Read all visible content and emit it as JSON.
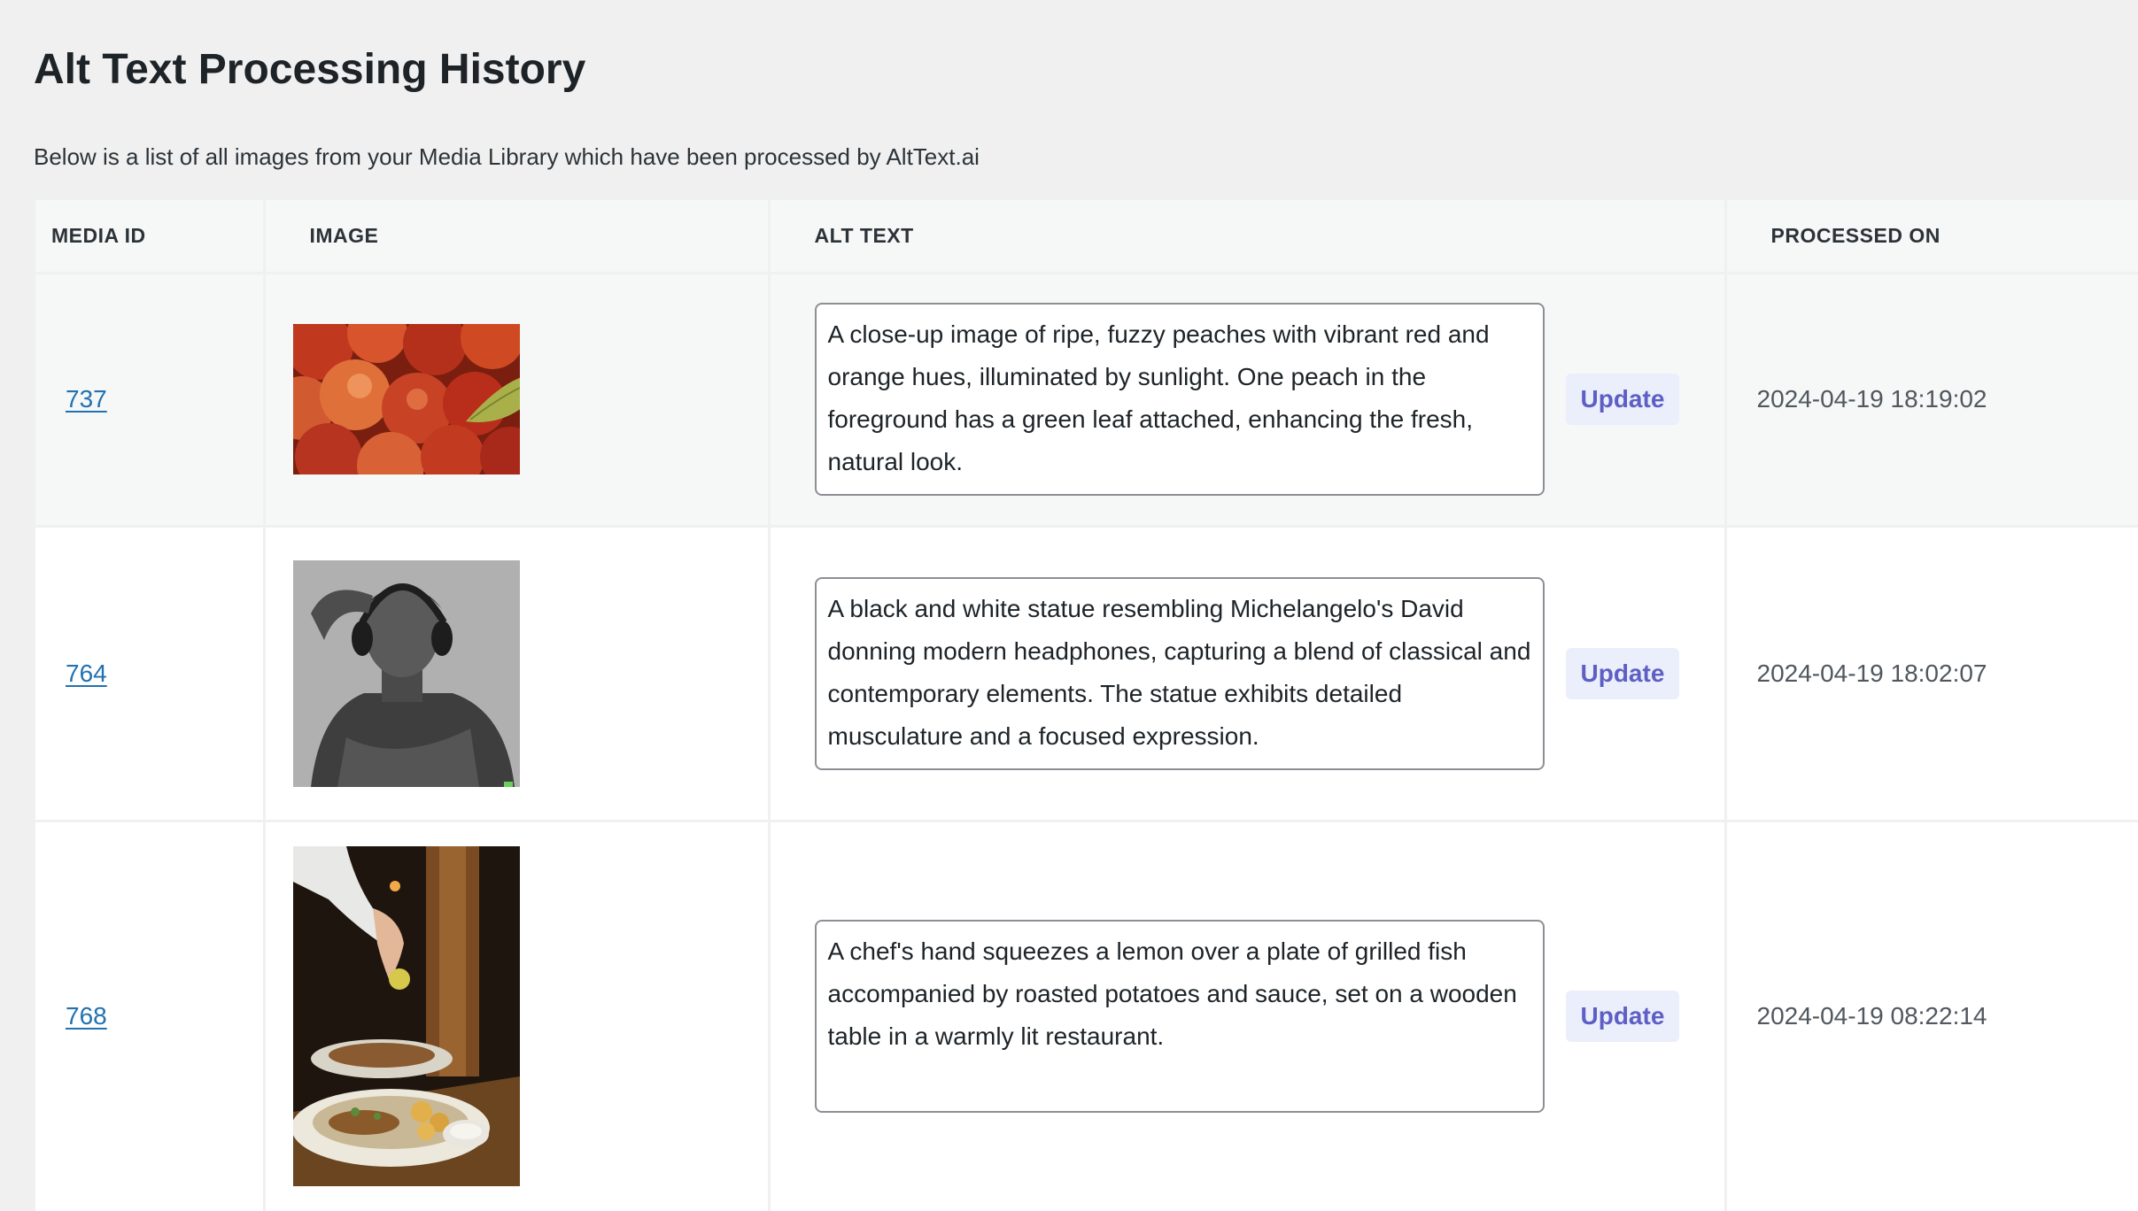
{
  "page": {
    "title": "Alt Text Processing History",
    "intro": "Below is a list of all images from your Media Library which have been processed by AltText.ai"
  },
  "table": {
    "headers": {
      "media_id": "MEDIA ID",
      "image": "IMAGE",
      "alt_text": "ALT TEXT",
      "processed_on": "PROCESSED ON"
    },
    "rows": [
      {
        "media_id": "737",
        "image_icon": "peaches-thumbnail",
        "alt_text": "A close-up image of ripe, fuzzy peaches with vibrant red and orange hues, illuminated by sunlight. One peach in the foreground has a green leaf attached, enhancing the fresh, natural look.",
        "update_label": "Update",
        "processed_on": "2024-04-19 18:19:02"
      },
      {
        "media_id": "764",
        "image_icon": "statue-headphones-thumbnail",
        "alt_text": "A black and white statue resembling Michelangelo's David donning modern headphones, capturing a blend of classical and contemporary elements. The statue exhibits detailed musculature and a focused expression.",
        "update_label": "Update",
        "processed_on": "2024-04-19 18:02:07"
      },
      {
        "media_id": "768",
        "image_icon": "chef-lemon-fish-thumbnail",
        "alt_text": "A chef's hand squeezes a lemon over a plate of grilled fish accompanied by roasted potatoes and sauce, set on a wooden table in a warmly lit restaurant.",
        "update_label": "Update",
        "processed_on": "2024-04-19 08:22:14"
      }
    ]
  },
  "colors": {
    "page_background": "#f0f0f1",
    "link": "#2271b1",
    "update_button_bg": "#ebeefb",
    "update_button_text": "#5d5fc4"
  }
}
